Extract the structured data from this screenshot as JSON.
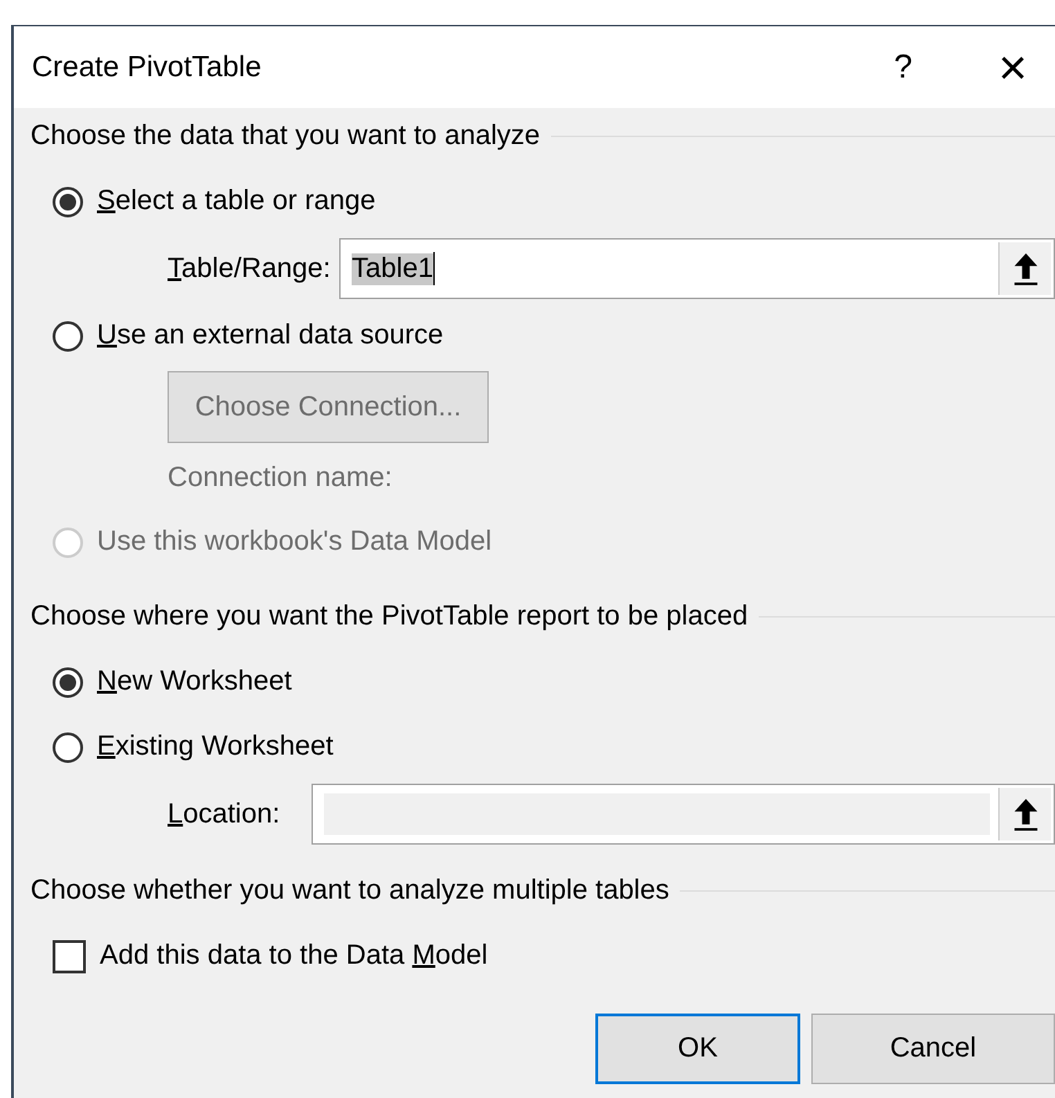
{
  "window": {
    "title": "Create PivotTable",
    "help": "?",
    "close": "×"
  },
  "sections": [
    {
      "heading": "Choose the data that you want to analyze",
      "items": [
        {
          "kind": "radio",
          "key": "S",
          "rest": "elect a table or range",
          "selected": true,
          "disabled": false
        },
        {
          "kind": "field",
          "key": "T",
          "rest": "able/Range:",
          "value": "Table1",
          "disabled": false
        },
        {
          "kind": "radio",
          "key": "U",
          "rest": "se an external data source",
          "selected": false,
          "disabled": false
        },
        {
          "kind": "button",
          "lead": "Choose Connection...",
          "disabled": true
        },
        {
          "kind": "text",
          "lead": "Connection name:",
          "disabled": true
        },
        {
          "kind": "radio",
          "lead": "Use this workbook's Data Model",
          "selected": false,
          "disabled": true
        }
      ]
    },
    {
      "heading": "Choose where you want the PivotTable report to be placed",
      "items": [
        {
          "kind": "radio",
          "key": "N",
          "rest": "ew Worksheet",
          "selected": true,
          "disabled": false
        },
        {
          "kind": "radio",
          "key": "E",
          "rest": "xisting Worksheet",
          "selected": false,
          "disabled": false
        },
        {
          "kind": "field",
          "key": "L",
          "rest": "ocation:",
          "disabled": true
        }
      ]
    },
    {
      "heading": "Choose whether you want to analyze multiple tables",
      "items": [
        {
          "kind": "checkbox",
          "lead": "Add this data to the Data ",
          "key": "M",
          "rest": "odel",
          "checked": false,
          "disabled": false
        }
      ]
    }
  ],
  "buttons": [
    {
      "label": "OK",
      "default": true
    },
    {
      "label": "Cancel",
      "default": false
    }
  ]
}
